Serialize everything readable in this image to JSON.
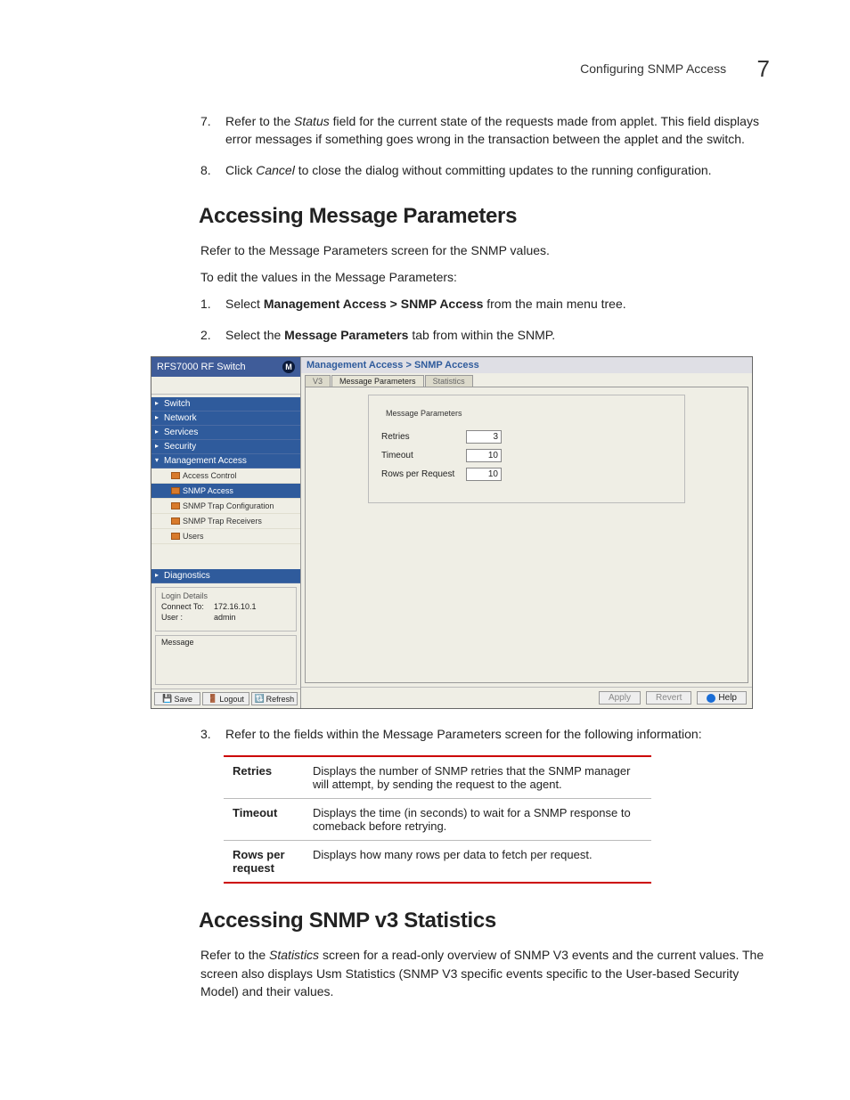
{
  "header": {
    "title": "Configuring SNMP Access",
    "page_num": "7"
  },
  "steps_top": [
    {
      "n": "7.",
      "text": [
        "Refer to the ",
        [
          "i",
          "Status"
        ],
        " field for the current state of the requests made from applet. This field displays error messages if something goes wrong in the transaction between the applet and the switch."
      ]
    },
    {
      "n": "8.",
      "text": [
        "Click ",
        [
          "i",
          "Cancel"
        ],
        " to close the dialog without committing updates to the running configuration."
      ]
    }
  ],
  "section1": {
    "heading": "Accessing Message Parameters",
    "p1": "Refer to the Message Parameters screen for the SNMP values.",
    "p2": "To edit the values in the Message Parameters:",
    "steps": [
      {
        "n": "1.",
        "text": [
          "Select ",
          [
            "b",
            "Management Access > SNMP Access"
          ],
          " from the main menu tree."
        ]
      },
      {
        "n": "2.",
        "text": [
          "Select the ",
          [
            "b",
            "Message Parameters"
          ],
          " tab from within the SNMP."
        ]
      }
    ],
    "step3": {
      "n": "3.",
      "text": "Refer to the fields within the Message Parameters screen for the following information:"
    }
  },
  "figure": {
    "product": "RFS7000 RF Switch",
    "tree": {
      "nodes": [
        "Switch",
        "Network",
        "Services",
        "Security",
        "Management Access"
      ],
      "subs": [
        "Access Control",
        "SNMP Access",
        "SNMP Trap Configuration",
        "SNMP Trap Receivers",
        "Users"
      ],
      "diag": "Diagnostics"
    },
    "login": {
      "legend": "Login Details",
      "connect_lbl": "Connect To:",
      "connect_val": "172.16.10.1",
      "user_lbl": "User :",
      "user_val": "admin"
    },
    "message_legend": "Message",
    "side_buttons": {
      "save": "Save",
      "logout": "Logout",
      "refresh": "Refresh"
    },
    "breadcrumb": "Management Access > SNMP Access",
    "tabs": {
      "v3": "V3",
      "mp": "Message Parameters",
      "stats": "Statistics"
    },
    "fieldset": {
      "legend": "Message Parameters",
      "rows": [
        {
          "lbl": "Retries",
          "val": "3"
        },
        {
          "lbl": "Timeout",
          "val": "10"
        },
        {
          "lbl": "Rows per Request",
          "val": "10"
        }
      ]
    },
    "footer": {
      "apply": "Apply",
      "revert": "Revert",
      "help": "Help"
    }
  },
  "def_table": [
    {
      "term": "Retries",
      "desc": "Displays the number of SNMP retries that the SNMP manager will attempt, by sending the request to the agent."
    },
    {
      "term": "Timeout",
      "desc": "Displays the time (in seconds) to wait for a SNMP response to comeback before retrying."
    },
    {
      "term": "Rows per request",
      "desc": "Displays how many rows per data to fetch per request."
    }
  ],
  "section2": {
    "heading": "Accessing SNMP v3 Statistics",
    "p1": [
      "Refer to the ",
      [
        "i",
        "Statistics"
      ],
      " screen for a read-only overview of SNMP V3 events and the current values. The screen also displays Usm Statistics (SNMP V3 specific events specific to the User-based Security Model) and their values."
    ]
  }
}
